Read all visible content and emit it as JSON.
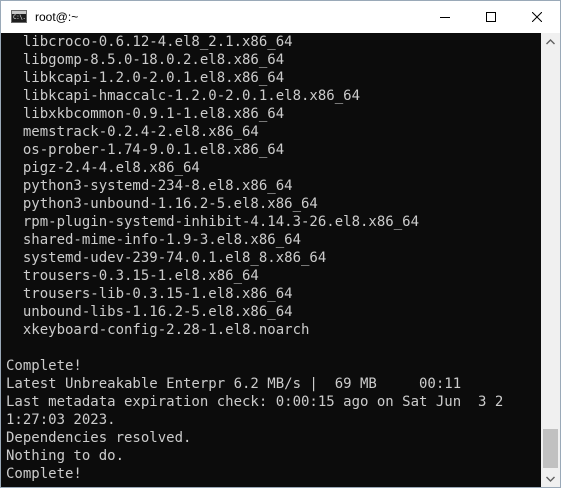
{
  "window": {
    "title": "root@:~",
    "app_icon_text": "C:\\.",
    "controls": {
      "minimize": "minimize-icon",
      "maximize": "maximize-icon",
      "close": "close-icon"
    }
  },
  "terminal": {
    "lines": [
      "  libcroco-0.6.12-4.el8_2.1.x86_64",
      "  libgomp-8.5.0-18.0.2.el8.x86_64",
      "  libkcapi-1.2.0-2.0.1.el8.x86_64",
      "  libkcapi-hmaccalc-1.2.0-2.0.1.el8.x86_64",
      "  libxkbcommon-0.9.1-1.el8.x86_64",
      "  memstrack-0.2.4-2.el8.x86_64",
      "  os-prober-1.74-9.0.1.el8.x86_64",
      "  pigz-2.4-4.el8.x86_64",
      "  python3-systemd-234-8.el8.x86_64",
      "  python3-unbound-1.16.2-5.el8.x86_64",
      "  rpm-plugin-systemd-inhibit-4.14.3-26.el8.x86_64",
      "  shared-mime-info-1.9-3.el8.x86_64",
      "  systemd-udev-239-74.0.1.el8_8.x86_64",
      "  trousers-0.3.15-1.el8.x86_64",
      "  trousers-lib-0.3.15-1.el8.x86_64",
      "  unbound-libs-1.16.2-5.el8.x86_64",
      "  xkeyboard-config-2.28-1.el8.noarch",
      "",
      "Complete!",
      "Latest Unbreakable Enterpr 6.2 MB/s |  69 MB     00:11",
      "Last metadata expiration check: 0:00:15 ago on Sat Jun  3 2",
      "1:27:03 2023.",
      "Dependencies resolved.",
      "Nothing to do.",
      "Complete!"
    ]
  },
  "scrollbar": {
    "up": "scroll-up-arrow-icon",
    "down": "scroll-down-arrow-icon",
    "position": 0.94
  }
}
